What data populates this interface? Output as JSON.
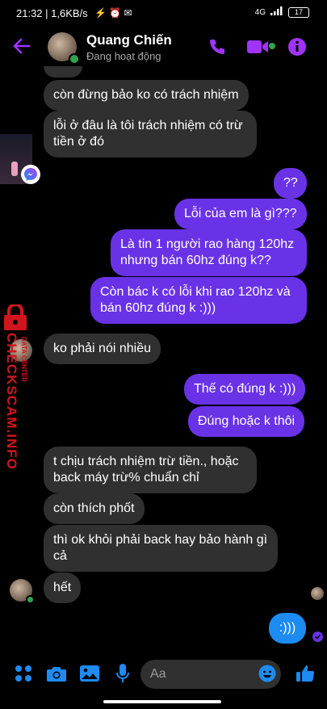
{
  "status_bar": {
    "time": "21:32",
    "network": "| 1,6KB/s",
    "signal_label": "4G",
    "battery": "17"
  },
  "header": {
    "name": "Quang Chiến",
    "status": "Đang hoạt động"
  },
  "messages": [
    {
      "side": "in",
      "text": "còn đừng bảo ko có trách nhiệm"
    },
    {
      "side": "in",
      "text": "lỗi ở đâu là tôi trách nhiệm có trừ tiền ở đó"
    },
    {
      "side": "out",
      "text": "??"
    },
    {
      "side": "out",
      "text": "Lỗi của em là gì???"
    },
    {
      "side": "out",
      "text": "Là tin 1 người rao hàng 120hz nhưng bán 60hz đúng k??"
    },
    {
      "side": "out",
      "text": "Còn bác k có lỗi khi rao 120hz và bán 60hz đúng k :)))"
    },
    {
      "side": "in",
      "text": "ko phải nói nhiều"
    },
    {
      "side": "out",
      "text": "Thế có đúng k :)))"
    },
    {
      "side": "out",
      "text": "Đúng hoặc k thôi"
    },
    {
      "side": "in",
      "text": "t chịu trách nhiệm trừ tiền., hoặc back máy trừ% chuẩn chỉ"
    },
    {
      "side": "in",
      "text": "còn thích phốt"
    },
    {
      "side": "in",
      "text": "thì ok khỏi phải back hay bảo hành gì cả"
    },
    {
      "side": "in",
      "text": "hết"
    },
    {
      "side": "out",
      "text": ":)))"
    }
  ],
  "watermark": {
    "main": "CHECKSCAM.INFO",
    "sub": "DATA CENTER"
  },
  "composer": {
    "placeholder": "Aa"
  },
  "colors": {
    "accent": "#a033ff",
    "outgoing": "#6a32e6",
    "outgoing_last": "#1d8bf2",
    "incoming": "#303030",
    "online": "#31a24c",
    "icon_blue": "#1d8bf2"
  }
}
